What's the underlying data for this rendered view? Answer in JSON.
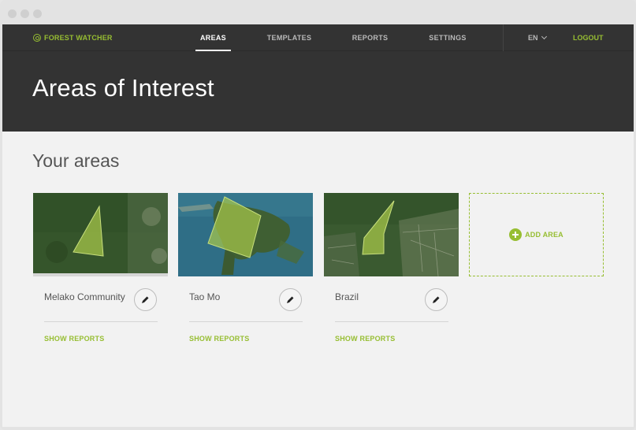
{
  "app": {
    "name": "FOREST WATCHER",
    "accent": "#97be32"
  },
  "nav": {
    "tabs": [
      {
        "label": "AREAS",
        "active": true
      },
      {
        "label": "TEMPLATES",
        "active": false
      },
      {
        "label": "REPORTS",
        "active": false
      },
      {
        "label": "SETTINGS",
        "active": false
      }
    ],
    "language": "EN",
    "logout": "LOGOUT"
  },
  "header": {
    "title": "Areas of Interest"
  },
  "main": {
    "section_title": "Your areas",
    "areas": [
      {
        "name": "Melako Community",
        "action": "SHOW REPORTS"
      },
      {
        "name": "Tao Mo",
        "action": "SHOW REPORTS"
      },
      {
        "name": "Brazil",
        "action": "SHOW REPORTS"
      }
    ],
    "add_area_label": "ADD AREA"
  }
}
